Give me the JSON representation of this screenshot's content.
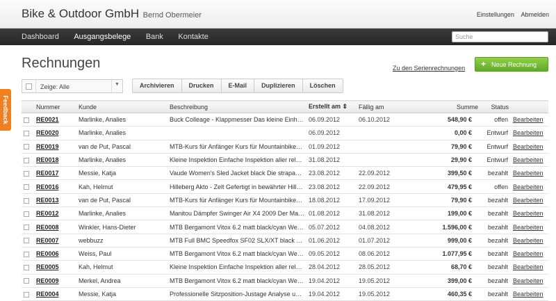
{
  "header": {
    "company": "Bike & Outdoor GmbH",
    "user": "Bernd Obermeier",
    "settings_label": "Einstellungen",
    "logout_label": "Abmelden"
  },
  "nav": {
    "items": [
      {
        "label": "Dashboard",
        "active": false
      },
      {
        "label": "Ausgangsbelege",
        "active": true
      },
      {
        "label": "Bank",
        "active": false
      },
      {
        "label": "Kontakte",
        "active": false
      }
    ],
    "search_placeholder": "Suche"
  },
  "feedback_label": "Feedback",
  "page": {
    "title": "Rechnungen",
    "serien_link": "Zu den Serienrechnungen",
    "new_button": "Neue Rechnung"
  },
  "toolbar": {
    "filter_value": "Zeige: Alle",
    "actions": [
      "Archivieren",
      "Drucken",
      "E-Mail",
      "Duplizieren",
      "Löschen"
    ]
  },
  "table": {
    "columns": {
      "nummer": "Nummer",
      "kunde": "Kunde",
      "beschreibung": "Beschreibung",
      "erstellt": "Erstellt am",
      "faellig": "Fällig am",
      "summe": "Summe",
      "status": "Status"
    },
    "edit_label": "Bearbeiten",
    "rows": [
      {
        "nummer": "RE0021",
        "kunde": "Marlinke, Analies",
        "beschreibung": "Buck Colleage - Klappmesser Das kleine Einh…",
        "erstellt": "06.09.2012",
        "faellig": "06.10.2012",
        "summe": "548,90 €",
        "status": "offen"
      },
      {
        "nummer": "RE0020",
        "kunde": "Marlinke, Analies",
        "beschreibung": "",
        "erstellt": "06.09.2012",
        "faellig": "",
        "summe": "0,00 €",
        "status": "Entwurf"
      },
      {
        "nummer": "RE0019",
        "kunde": "van de Put, Pascal",
        "beschreibung": "MTB-Kurs für Anfänger Kurs für Mountainbike…",
        "erstellt": "01.09.2012",
        "faellig": "",
        "summe": "79,90 €",
        "status": "Entwurf"
      },
      {
        "nummer": "RE0018",
        "kunde": "Marlinke, Analies",
        "beschreibung": "Kleine Inspektion Einfache Inspektion aller rel…",
        "erstellt": "31.08.2012",
        "faellig": "",
        "summe": "29,90 €",
        "status": "Entwurf"
      },
      {
        "nummer": "RE0017",
        "kunde": "Messie, Katja",
        "beschreibung": "Vaude Women's Sled Jacket black Die strapa…",
        "erstellt": "23.08.2012",
        "faellig": "22.09.2012",
        "summe": "399,50 €",
        "status": "bezahlt"
      },
      {
        "nummer": "RE0016",
        "kunde": "Kah, Helmut",
        "beschreibung": "Hilleberg Akto - Zelt Gefertigt in bewährter Hill…",
        "erstellt": "23.08.2012",
        "faellig": "22.09.2012",
        "summe": "479,95 €",
        "status": "offen"
      },
      {
        "nummer": "RE0013",
        "kunde": "van de Put, Pascal",
        "beschreibung": "MTB-Kurs für Anfänger Kurs für Mountainbike…",
        "erstellt": "18.08.2012",
        "faellig": "17.09.2012",
        "summe": "79,90 €",
        "status": "bezahlt"
      },
      {
        "nummer": "RE0012",
        "kunde": "Marlinke, Analies",
        "beschreibung": "Manitou Dämpfer Swinger Air X4 2009 Der Ma…",
        "erstellt": "01.08.2012",
        "faellig": "31.08.2012",
        "summe": "199,00 €",
        "status": "bezahlt"
      },
      {
        "nummer": "RE0008",
        "kunde": "Winkler, Hans-Dieter",
        "beschreibung": "MTB Bergamont Vitox 6.2 matt black/cyan We…",
        "erstellt": "05.07.2012",
        "faellig": "04.08.2012",
        "summe": "1.596,00 €",
        "status": "bezahlt"
      },
      {
        "nummer": "RE0007",
        "kunde": "webbuzz",
        "beschreibung": "MTB Full BMC Speedfox SF02 SLX/XT black …",
        "erstellt": "01.06.2012",
        "faellig": "01.07.2012",
        "summe": "999,00 €",
        "status": "bezahlt"
      },
      {
        "nummer": "RE0006",
        "kunde": "Weiss, Paul",
        "beschreibung": "MTB Bergamont Vitox 6.2 matt black/cyan We…",
        "erstellt": "09.05.2012",
        "faellig": "08.06.2012",
        "summe": "1.077,95 €",
        "status": "bezahlt"
      },
      {
        "nummer": "RE0005",
        "kunde": "Kah, Helmut",
        "beschreibung": "Kleine Inspektion Einfache Inspektion aller rel…",
        "erstellt": "28.04.2012",
        "faellig": "28.05.2012",
        "summe": "68,70 €",
        "status": "bezahlt"
      },
      {
        "nummer": "RE0009",
        "kunde": "Merkel, Andrea",
        "beschreibung": "MTB Bergamont Vitox 6.2 matt black/cyan We…",
        "erstellt": "19.04.2012",
        "faellig": "19.05.2012",
        "summe": "399,00 €",
        "status": "bezahlt"
      },
      {
        "nummer": "RE0004",
        "kunde": "Messie, Katja",
        "beschreibung": "Professionelle Sitzposition-Justage Analyse u…",
        "erstellt": "19.04.2012",
        "faellig": "19.05.2012",
        "summe": "460,35 €",
        "status": "bezahlt"
      }
    ]
  },
  "colors": {
    "accent_green": "#6cb33e",
    "feedback_orange": "#ef7f21",
    "nav_dark": "#2e2e2e"
  }
}
